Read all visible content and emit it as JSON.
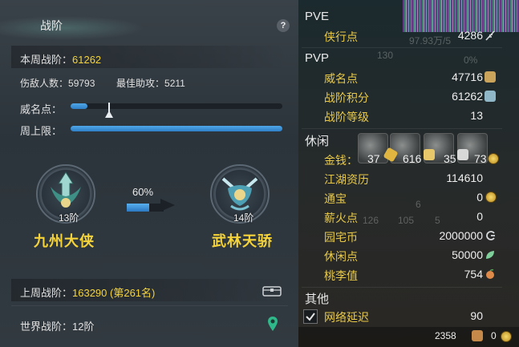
{
  "left": {
    "title": "战阶",
    "help_label": "?",
    "weekly": {
      "label": "本周战阶：",
      "value": "61262"
    },
    "injury_count": {
      "label": "伤敌人数：",
      "value": "59793"
    },
    "best_assist": {
      "label": "最佳助攻：",
      "value": "5211"
    },
    "prestige_label": "威名点：",
    "prestige_fraction": 0.08,
    "weekly_cap_label": "周上限：",
    "weekly_cap_fraction": 1.0,
    "current_tier": {
      "rank": "13阶",
      "name": "九州大侠"
    },
    "next_tier": {
      "rank": "14阶",
      "name": "武林天骄"
    },
    "progress": {
      "label": "60%",
      "fraction": 0.6
    },
    "last_week": {
      "label": "上周战阶：",
      "value": "163290 (第261名)"
    },
    "world": {
      "label": "世界战阶：",
      "value": "12阶"
    }
  },
  "right": {
    "pve": {
      "header": "PVE",
      "items": [
        {
          "label": "侠行点",
          "value": "4286"
        }
      ]
    },
    "pvp": {
      "header": "PVP",
      "items": [
        {
          "label": "威名点",
          "value": "47716"
        },
        {
          "label": "战阶积分",
          "value": "61262"
        },
        {
          "label": "战阶等级",
          "value": "13"
        }
      ]
    },
    "leisure": {
      "header": "休闲",
      "money_label": "金钱：",
      "money": {
        "gold": "37",
        "silver": "616",
        "copper": "35",
        "other": "73"
      },
      "items": [
        {
          "label": "江湖资历",
          "value": "114610"
        },
        {
          "label": "通宝",
          "value": "0"
        },
        {
          "label": "薪火点",
          "value": "0"
        },
        {
          "label": "园宅币",
          "value": "2000000"
        },
        {
          "label": "休闲点",
          "value": "50000"
        },
        {
          "label": "桃李值",
          "value": "754"
        }
      ]
    },
    "other": {
      "header": "其他",
      "latency_label": "网络延迟",
      "latency_value": "90"
    },
    "footer": {
      "value_a": "2358",
      "value_b": "0"
    },
    "ghosts": {
      "g1": "130",
      "g2": "0%",
      "g3": "97.93万/5",
      "g4": "126",
      "g5": "105",
      "g6": "5",
      "g7": "6"
    },
    "colors": {
      "accent_yellow": "#e8c94a",
      "bar_blue": "#3a8fd6"
    }
  }
}
